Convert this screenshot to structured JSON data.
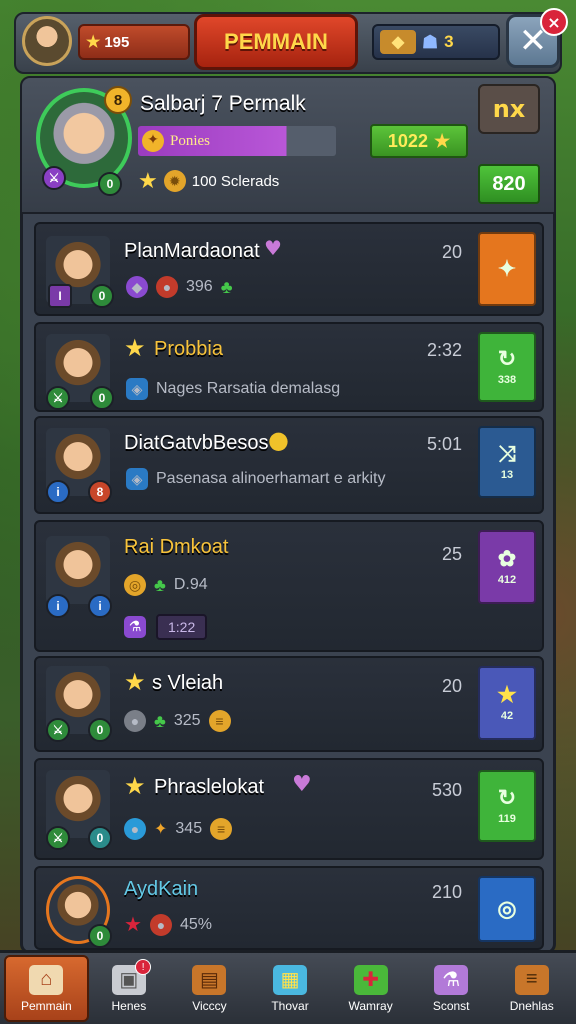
{
  "topbar": {
    "coins": "195",
    "title": "PEMMAIN",
    "gems": "3",
    "close_badge": "×"
  },
  "profile": {
    "level": "8",
    "name": "Salbarj 7 Permalk",
    "rank_label": "Ponies",
    "rank_progress": 0.75,
    "stars_text": "100 Sclerads",
    "score": "1022",
    "side_button_icon": "nx",
    "green_button": "820"
  },
  "rows": [
    {
      "name": "PlanMardaonat",
      "time": "20",
      "stat": "396",
      "button_color": "#e5761e",
      "button_glyph": "✦",
      "button_label": ""
    },
    {
      "name": "Probbia",
      "time": "2:32",
      "sub": "Nages Rarsatia demalasg",
      "button_color": "#3fb43a",
      "button_glyph": "↻",
      "button_label": "338"
    },
    {
      "name": "DiatGatvbBesos",
      "time": "5:01",
      "sub": "Pasenasa alinoerhamart e arkity",
      "button_color": "#2b5a92",
      "button_glyph": "⤨",
      "button_label": "13"
    },
    {
      "name": "Rai Dmkoat",
      "time": "25",
      "stat": "D.94",
      "chip": "1:22",
      "button_color": "#7a3aa8",
      "button_glyph": "✿",
      "button_label": "412"
    },
    {
      "name": "s Vleiah",
      "time": "20",
      "stat": "325",
      "button_color": "#4a58b8",
      "button_glyph": "★",
      "button_label": "42"
    },
    {
      "name": "Phraslelokat",
      "time": "530",
      "stat": "345",
      "button_color": "#3fb43a",
      "button_glyph": "↻",
      "button_label": "119"
    },
    {
      "name": "AydKain",
      "time": "210",
      "stat": "45%",
      "button_color": "#2a6bc4",
      "button_glyph": "◎",
      "button_label": ""
    }
  ],
  "nav": [
    {
      "label": "Pemmain",
      "icon": "house-icon"
    },
    {
      "label": "Henes",
      "icon": "box-icon"
    },
    {
      "label": "Vicccy",
      "icon": "chest-icon"
    },
    {
      "label": "Thovar",
      "icon": "gift-icon"
    },
    {
      "label": "Wamray",
      "icon": "present-icon"
    },
    {
      "label": "Sconst",
      "icon": "potion-icon"
    },
    {
      "label": "Dnehlas",
      "icon": "menu-icon"
    }
  ]
}
